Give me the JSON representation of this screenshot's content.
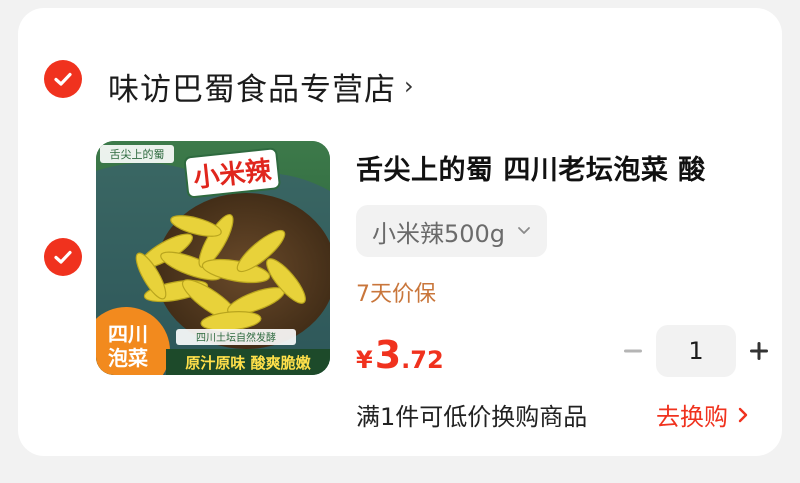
{
  "shop": {
    "name": "味访巴蜀食品专营店",
    "chevron": "›"
  },
  "product": {
    "title": "舌尖上的蜀 四川老坛泡菜 酸",
    "variant": "小米辣500g",
    "guarantee": "7天价保",
    "price": {
      "symbol": "¥",
      "integer": "3",
      "decimal": ".72"
    },
    "quantity": "1",
    "image_text": {
      "brand": "舌尖上的蜀",
      "badge": "小米辣",
      "corner_line1": "四川",
      "corner_line2": "泡菜",
      "tagline": "四川土坛自然发酵",
      "slogan": "原汁原味 酸爽脆嫩"
    }
  },
  "promo": {
    "text": "满1件可低价换购商品",
    "link": "去换购"
  },
  "colors": {
    "accent": "#f0321e",
    "guarantee": "#c9763b",
    "card_bg": "#ffffff",
    "page_bg": "#f2f2f2"
  },
  "icons": {
    "shop_check": "check-circle-icon",
    "item_check": "check-circle-icon",
    "variant_dropdown": "chevron-down-icon",
    "decrease": "minus-icon",
    "increase": "plus-icon",
    "swap_arrow": "chevron-right-icon"
  }
}
